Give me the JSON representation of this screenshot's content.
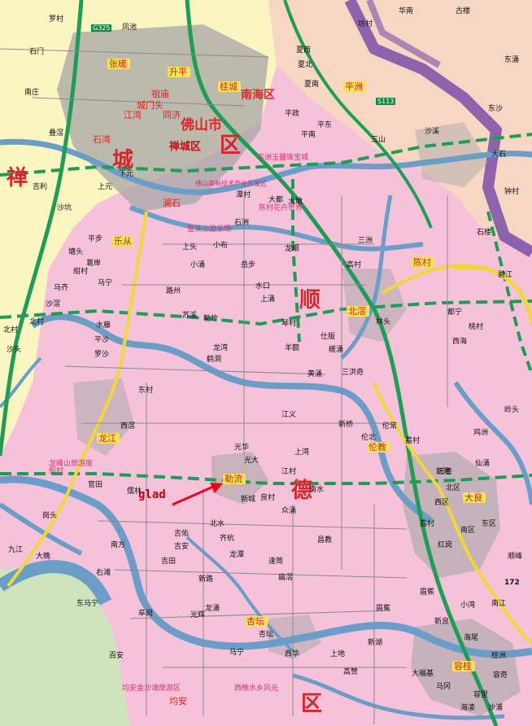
{
  "map": {
    "annotation": "glad",
    "colors": {
      "shunde_land": "#f6c2da",
      "nanhai_land": "#fbf5c2",
      "guangzhou_land": "#f7d6c4",
      "xinhui_land": "#cfe4bc",
      "water": "#6a9ec9",
      "urban": "#a6a6a6",
      "expressway": "#1f9d57",
      "arterial": "#f0d83a",
      "border_purple": "#7a4fa8",
      "annotation_red": "#e2091a"
    },
    "regions": {
      "chancheng_big_1": "禅",
      "chancheng_big_2": "城",
      "chancheng_big_3": "区",
      "shunde_big_1": "顺",
      "shunde_big_2": "德",
      "shunde_big_3": "区",
      "foshan_city": "佛山市",
      "nanhai_district": "南海区",
      "chancheng_district": "禅城区"
    },
    "places_red": {
      "lecong": "乐从",
      "chencun": "陈村",
      "beijiao": "北滘",
      "longjiang": "龙江",
      "lunjiao": "伦教",
      "ronggui": "容桂",
      "daliang": "大良",
      "xingtan": "杏坛",
      "junan": "均安",
      "leliu": "勒流",
      "zhangcha": "张槎",
      "shiwan": "石湾",
      "lanshi": "澜石",
      "jiangwan": "江湾",
      "zumiao": "祖庙",
      "chengmenkou": "城门头",
      "tongji": "同济",
      "guicheng": "桂城",
      "pingzhou": "平洲",
      "kaibian": "升平"
    },
    "scenic": {
      "longfengshan": "龙峰山旅游度假村",
      "pingzhou_jade": "平洲玉器珠宝城",
      "foshan_tech": "佛山高新技术产业开发区",
      "chencun_flower": "陈村花卉世界",
      "chancheng_shacheng": "登莱沙游乐场",
      "shunde_bridge": "顺德港",
      "xinhui_mansion": "西樵水乡风光",
      "junan_jin": "均安金沙滩旅游区"
    },
    "towns": {
      "t01": "罗村",
      "t02": "凤池",
      "t03": "叠滘",
      "t04": "南庄",
      "t05": "石门",
      "t06": "上元",
      "t07": "下元",
      "t08": "沙坑",
      "t09": "吉利",
      "t10": "塘头",
      "t11": "平步",
      "t12": "马宁",
      "t13": "葛岸",
      "t14": "路州",
      "t15": "勒竹",
      "t16": "大墩",
      "t17": "小涌",
      "t18": "龙眼",
      "t19": "岳步",
      "t20": "石洲",
      "t21": "三洲",
      "t22": "碧江",
      "t23": "都宁",
      "t24": "桃村",
      "t25": "西海",
      "t26": "水口",
      "t27": "上涌",
      "t28": "琴村",
      "t29": "黄涌",
      "t30": "林头",
      "t31": "槎涌",
      "t32": "羊额",
      "t33": "仕版",
      "t34": "三洪奇",
      "t35": "新桥",
      "t36": "光华",
      "t37": "光大",
      "t38": "上湾",
      "t39": "江村",
      "t40": "众涌",
      "t41": "南水",
      "t42": "良村",
      "t43": "新城",
      "t44": "吉佑",
      "t45": "吉安",
      "t46": "吉田",
      "t47": "新路",
      "t48": "龙潭",
      "t49": "逢简",
      "t50": "昌教",
      "t51": "光辉",
      "t52": "马宁",
      "t53": "北水",
      "t54": "齐杭",
      "t55": "扁滘",
      "t56": "西华",
      "t57": "新湖",
      "t58": "高赞",
      "t59": "南江",
      "t60": "眉蕉",
      "t61": "海尾",
      "t62": "容奇",
      "t63": "马冈",
      "t64": "沙浦",
      "t65": "海凌",
      "t66": "大福基",
      "t67": "顺峰",
      "t68": "小湾",
      "t69": "新良",
      "t70": "三桂",
      "t71": "仙涌",
      "t72": "东村",
      "t73": "西滘",
      "t74": "儒林",
      "t75": "右滩",
      "t76": "东马宁",
      "t77": "大晚",
      "t78": "九江",
      "t79": "南方",
      "t80": "百安",
      "t81": "阜岗",
      "t82": "龙涌",
      "t83": "高村",
      "t84": "上地",
      "t85": "江义",
      "t86": "沙滘",
      "t87": "北村",
      "t88": "马齐",
      "t89": "水藤",
      "t90": "绀村",
      "t91": "新隆",
      "t92": "伦常",
      "t93": "荔村",
      "t94": "鸡洲",
      "t95": "岭头",
      "t96": "平政",
      "t97": "平东",
      "t98": "平南",
      "t99": "三山",
      "t100": "大石",
      "t101": "钟村",
      "t102": "石楼",
      "t103": "东沙",
      "t104": "沙溪",
      "t105": "东涌",
      "t106": "古楼",
      "t107": "华南",
      "t108": "坊村",
      "t109": "夏北",
      "t110": "夏南",
      "t111": "夏西",
      "t112": "东区",
      "t113": "西区",
      "t114": "南区",
      "t115": "北区",
      "t116": "眉蕉",
      "t117": "伦北",
      "t118": "荔村",
      "t119": "大都",
      "t120": "龙湾",
      "t121": "沙头",
      "t122": "北村",
      "t123": "岗头",
      "t124": "官田",
      "t125": "苏溪",
      "t126": "鹤洞",
      "t127": "上头",
      "t128": "小布",
      "t129": "潭村",
      "t130": "罗沙",
      "t131": "平沙",
      "t132": "桂洲",
      "t133": "容里",
      "t134": "红岗",
      "t135": "杏坛"
    },
    "road_labels": {
      "r1": "G325",
      "r2": "S113",
      "r3": "172"
    }
  }
}
